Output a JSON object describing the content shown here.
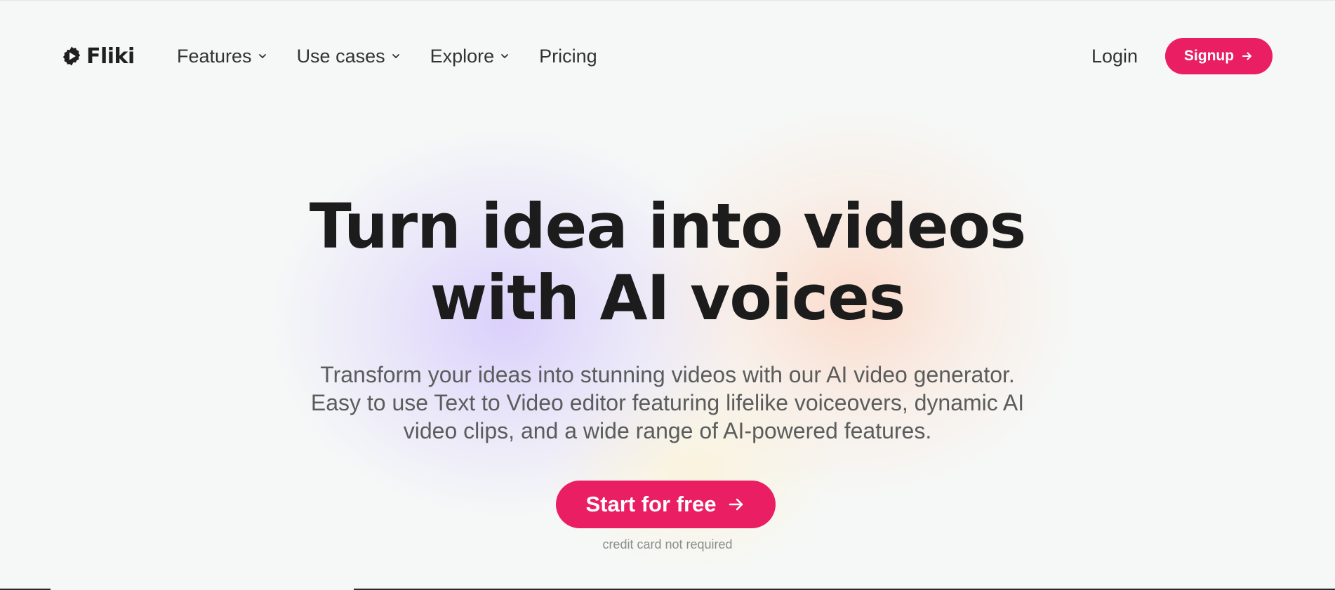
{
  "brand": {
    "name": "Fliki",
    "logo_icon": "play-gear-icon",
    "accent_color": "#e91e63"
  },
  "nav": {
    "items": [
      {
        "label": "Features",
        "has_dropdown": true,
        "icon": "chevron-down-icon"
      },
      {
        "label": "Use cases",
        "has_dropdown": true,
        "icon": "chevron-down-icon"
      },
      {
        "label": "Explore",
        "has_dropdown": true,
        "icon": "chevron-down-icon"
      },
      {
        "label": "Pricing",
        "has_dropdown": false
      }
    ],
    "login_label": "Login",
    "signup_label": "Signup",
    "signup_icon": "arrow-right-icon"
  },
  "hero": {
    "headline_line1": "Turn idea into videos",
    "headline_line2": "with AI voices",
    "subhead_line1": "Transform your ideas into stunning videos with our AI video generator.",
    "subhead_line2": "Easy to use Text to Video editor featuring lifelike voiceovers, dynamic AI",
    "subhead_line3": "video clips, and a wide range of AI-powered features.",
    "cta_label": "Start for free",
    "cta_icon": "arrow-right-icon",
    "cta_note": "credit card not required"
  }
}
